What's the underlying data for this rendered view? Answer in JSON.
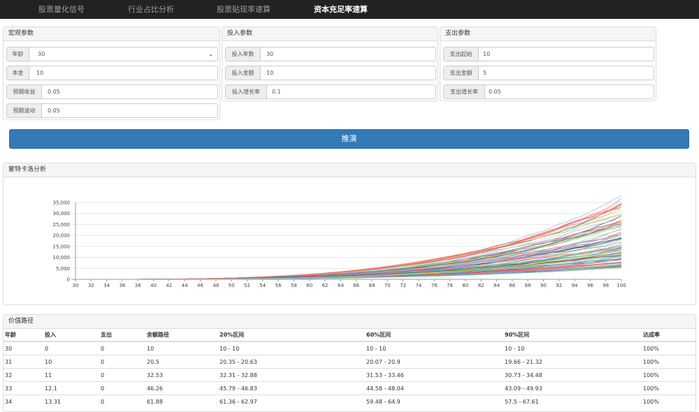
{
  "nav": {
    "items": [
      "股票量化信号",
      "行业占比分析",
      "股票贴现率速算",
      "资本充足率速算"
    ],
    "active_index": 3
  },
  "macro": {
    "title": "宏观参数",
    "age_label": "年龄",
    "age_value": "30",
    "principal_label": "本金",
    "principal_value": "10",
    "return_label": "预期收益",
    "return_value": "0.05",
    "vol_label": "预期波动",
    "vol_value": "0.05"
  },
  "invest": {
    "title": "投入参数",
    "years_label": "投入年数",
    "years_value": "30",
    "amount_label": "投入金额",
    "amount_value": "10",
    "growth_label": "投入增长率",
    "growth_value": "0.1"
  },
  "spend": {
    "title": "支出参数",
    "start_label": "支出起始",
    "start_value": "10",
    "amount_label": "支出金额",
    "amount_value": "5",
    "growth_label": "支出增长率",
    "growth_value": "0.05"
  },
  "run_label": "推演",
  "mc_panel": {
    "title": "蒙特卡洛分析"
  },
  "path_panel": {
    "title": "价值路径"
  },
  "chart_data": {
    "type": "line",
    "x_start": 30,
    "x_end": 100,
    "x_ticks": [
      "30",
      "32",
      "34",
      "36",
      "38",
      "40",
      "42",
      "44",
      "46",
      "48",
      "50",
      "52",
      "54",
      "56",
      "58",
      "60",
      "62",
      "64",
      "66",
      "68",
      "70",
      "72",
      "74",
      "76",
      "78",
      "80",
      "82",
      "84",
      "86",
      "88",
      "90",
      "92",
      "94",
      "96",
      "98",
      "100"
    ],
    "y_ticks": [
      "0",
      "5,000",
      "10,000",
      "15,000",
      "20,000",
      "25,000",
      "30,000",
      "35,000"
    ],
    "ylim": [
      0,
      35000
    ],
    "grid": true,
    "series_count": 100,
    "final_value_range": [
      5500,
      34000
    ],
    "colors": [
      "#7cb5ec",
      "#434348",
      "#90ed7d",
      "#f7a35c",
      "#8085e9",
      "#f15c80",
      "#e4d354",
      "#2b908f",
      "#f45b5b",
      "#91e8e1"
    ]
  },
  "table": {
    "headers": [
      "年龄",
      "投入",
      "支出",
      "余额路径",
      "20%区间",
      "60%区间",
      "90%区间",
      "达成率"
    ],
    "rows": [
      [
        "30",
        "0",
        "0",
        "10",
        "10 - 10",
        "10 - 10",
        "10 - 10",
        "100%"
      ],
      [
        "31",
        "10",
        "0",
        "20.5",
        "20.35 - 20.63",
        "20.07 - 20.9",
        "19.66 - 21.32",
        "100%"
      ],
      [
        "32",
        "11",
        "0",
        "32.53",
        "32.31 - 32.88",
        "31.53 - 33.46",
        "30.73 - 34.48",
        "100%"
      ],
      [
        "33",
        "12.1",
        "0",
        "46.26",
        "45.79 - 46.83",
        "44.58 - 48.04",
        "43.09 - 49.93",
        "100%"
      ],
      [
        "34",
        "13.31",
        "0",
        "61.88",
        "61.36 - 62.97",
        "59.48 - 64.9",
        "57.5 - 67.61",
        "100%"
      ]
    ]
  }
}
